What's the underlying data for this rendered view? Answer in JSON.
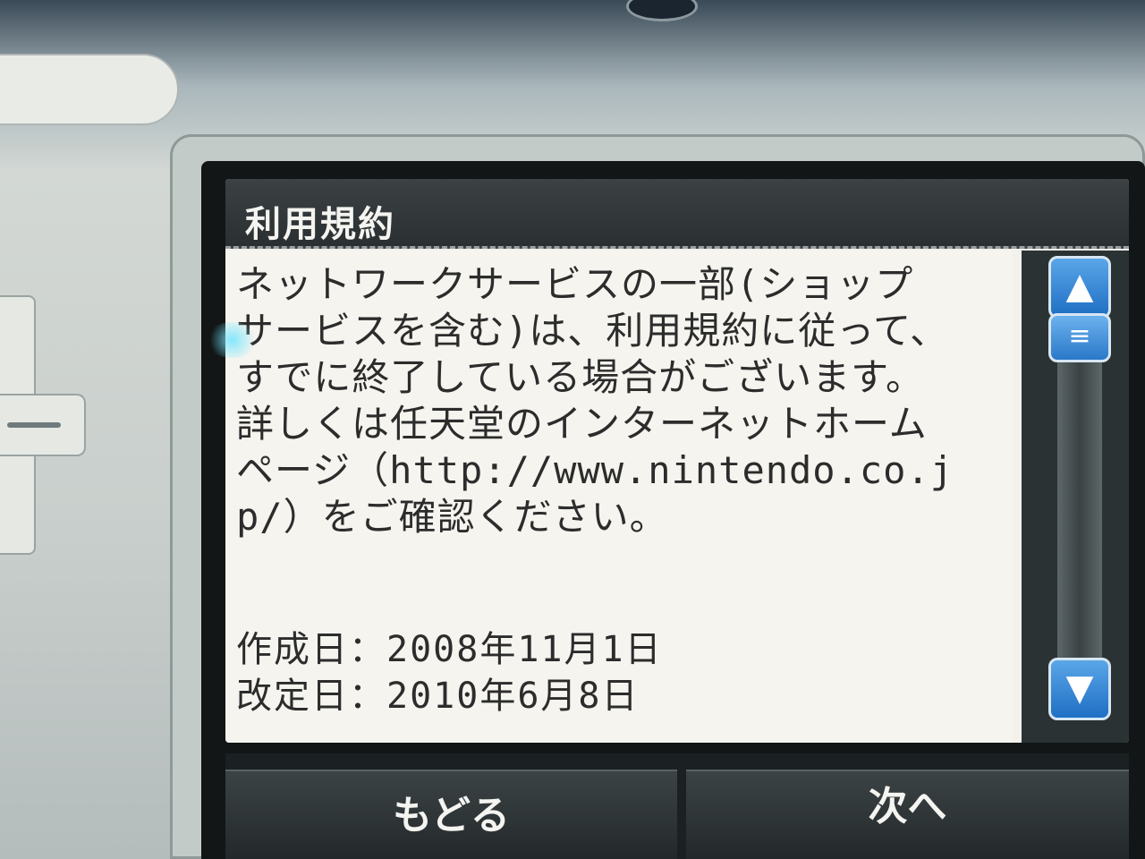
{
  "window": {
    "title": "利用規約"
  },
  "notice": {
    "lines": [
      "ネットワークサービスの一部(ショップ",
      "サービスを含む)は、利用規約に従って、",
      "すでに終了している場合がございます。",
      "詳しくは任天堂のインターネットホーム",
      "ページ（http://www.nintendo.co.j",
      "p/）をご確認ください。"
    ]
  },
  "dates": {
    "created": "作成日：2008年11月1日",
    "revised": "改定日：2010年6月8日"
  },
  "scrollbar": {
    "up_icon": "triangle-up-icon",
    "thumb_icon": "grip-lines-icon",
    "down_icon": "triangle-down-icon",
    "up_glyph": "▲",
    "thumb_glyph": "≡",
    "down_glyph": "▼",
    "accent_color": "#1f6fc4"
  },
  "buttons": {
    "back_label": "もどる",
    "next_label": "次へ"
  }
}
